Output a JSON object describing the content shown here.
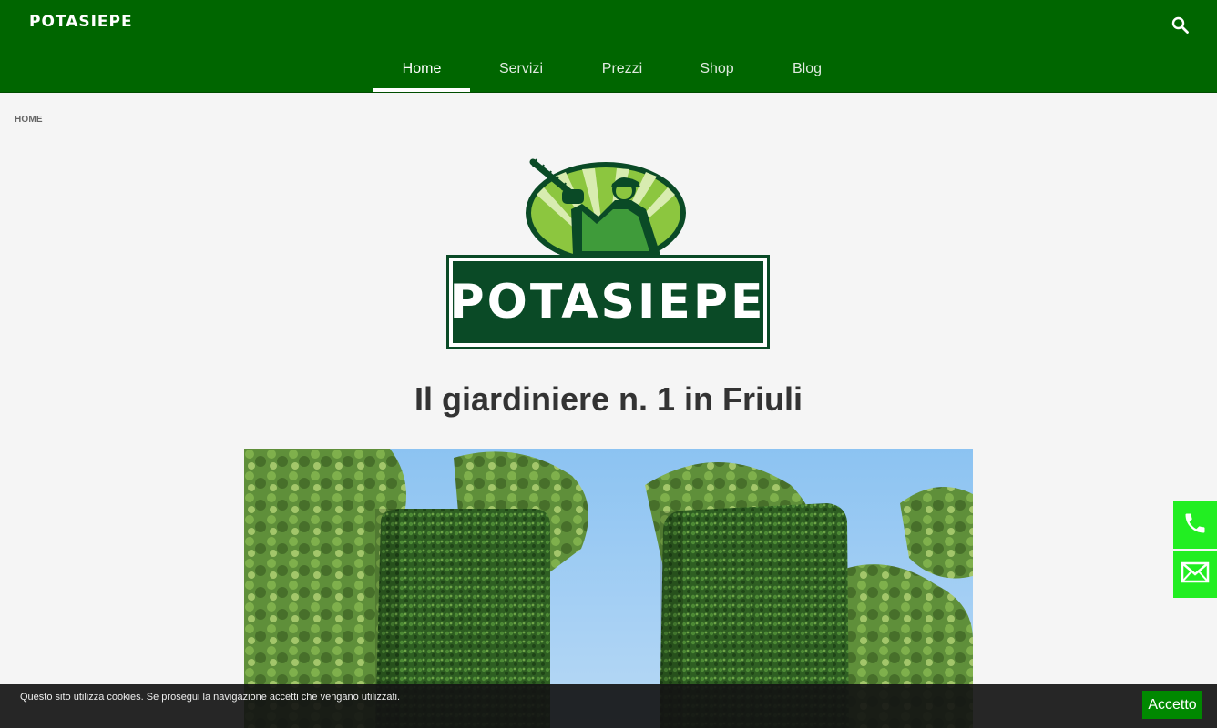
{
  "header": {
    "logo_text": "POTASIEPE",
    "search_icon": "search-icon"
  },
  "nav": {
    "items": [
      {
        "label": "Home",
        "active": true
      },
      {
        "label": "Servizi",
        "active": false
      },
      {
        "label": "Prezzi",
        "active": false
      },
      {
        "label": "Shop",
        "active": false
      },
      {
        "label": "Blog",
        "active": false
      }
    ]
  },
  "breadcrumb": "HOME",
  "hero": {
    "logo_text": "POTASIEPE",
    "headline": "Il giardiniere n. 1 in Friuli"
  },
  "side_buttons": {
    "phone_icon": "phone-icon",
    "mail_icon": "mail-icon"
  },
  "cookie": {
    "text": "Questo sito utilizza cookies. Se prosegui la navigazione accetti che vengano utilizzati.",
    "accept_label": "Accetto"
  },
  "colors": {
    "header_bg": "#006600",
    "side_button": "#22ee22",
    "accept_button": "#008800",
    "logo_dark_green": "#0a4a26",
    "logo_light_green": "#8cc63f"
  }
}
